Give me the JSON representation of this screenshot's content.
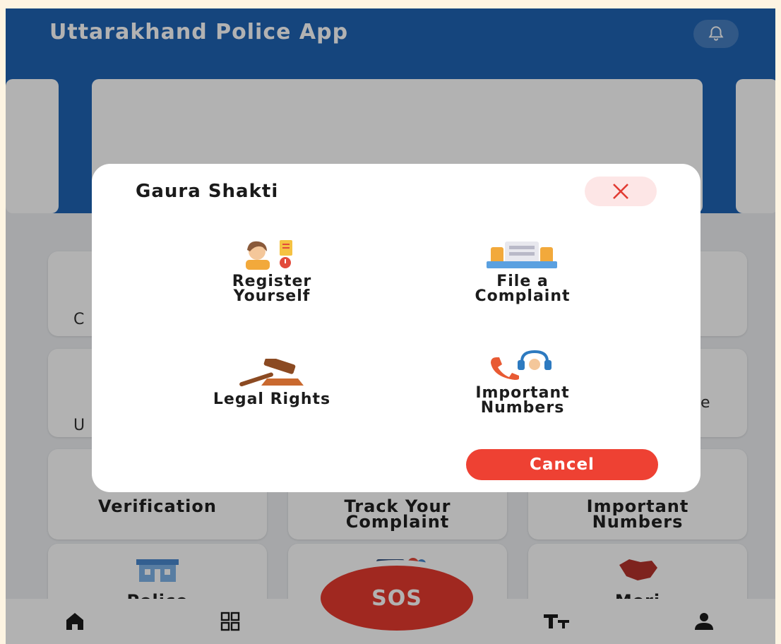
{
  "app": {
    "title": "Uttarakhand Police App",
    "icons": {
      "bell": "bell-icon",
      "sos": "sos-button"
    }
  },
  "background_tiles": {
    "row3": [
      "Verification",
      "Track Your Complaint",
      "Important Numbers"
    ],
    "row4": [
      "Police",
      "",
      "Meri"
    ],
    "partial_letters": [
      "C",
      "U",
      "e"
    ]
  },
  "sos_label": "SOS",
  "bottom_nav": [
    "home-icon",
    "grid-icon",
    "text-size-icon",
    "profile-icon"
  ],
  "modal": {
    "title": "Gaura Shakti",
    "options": [
      {
        "label_line1": "Register",
        "label_line2": "Yourself",
        "icon": "register-person-icon"
      },
      {
        "label_line1": "File a",
        "label_line2": "Complaint",
        "icon": "complaint-files-icon"
      },
      {
        "label_line1": "Legal Rights",
        "label_line2": "",
        "icon": "gavel-icon"
      },
      {
        "label_line1": "Important",
        "label_line2": "Numbers",
        "icon": "phone-headset-icon"
      }
    ],
    "cancel_label": "Cancel"
  },
  "colors": {
    "header_blue": "#1f63b4",
    "sos_red": "#e63a2e",
    "cancel_red": "#ee4133",
    "close_bg": "#fde6e6"
  }
}
